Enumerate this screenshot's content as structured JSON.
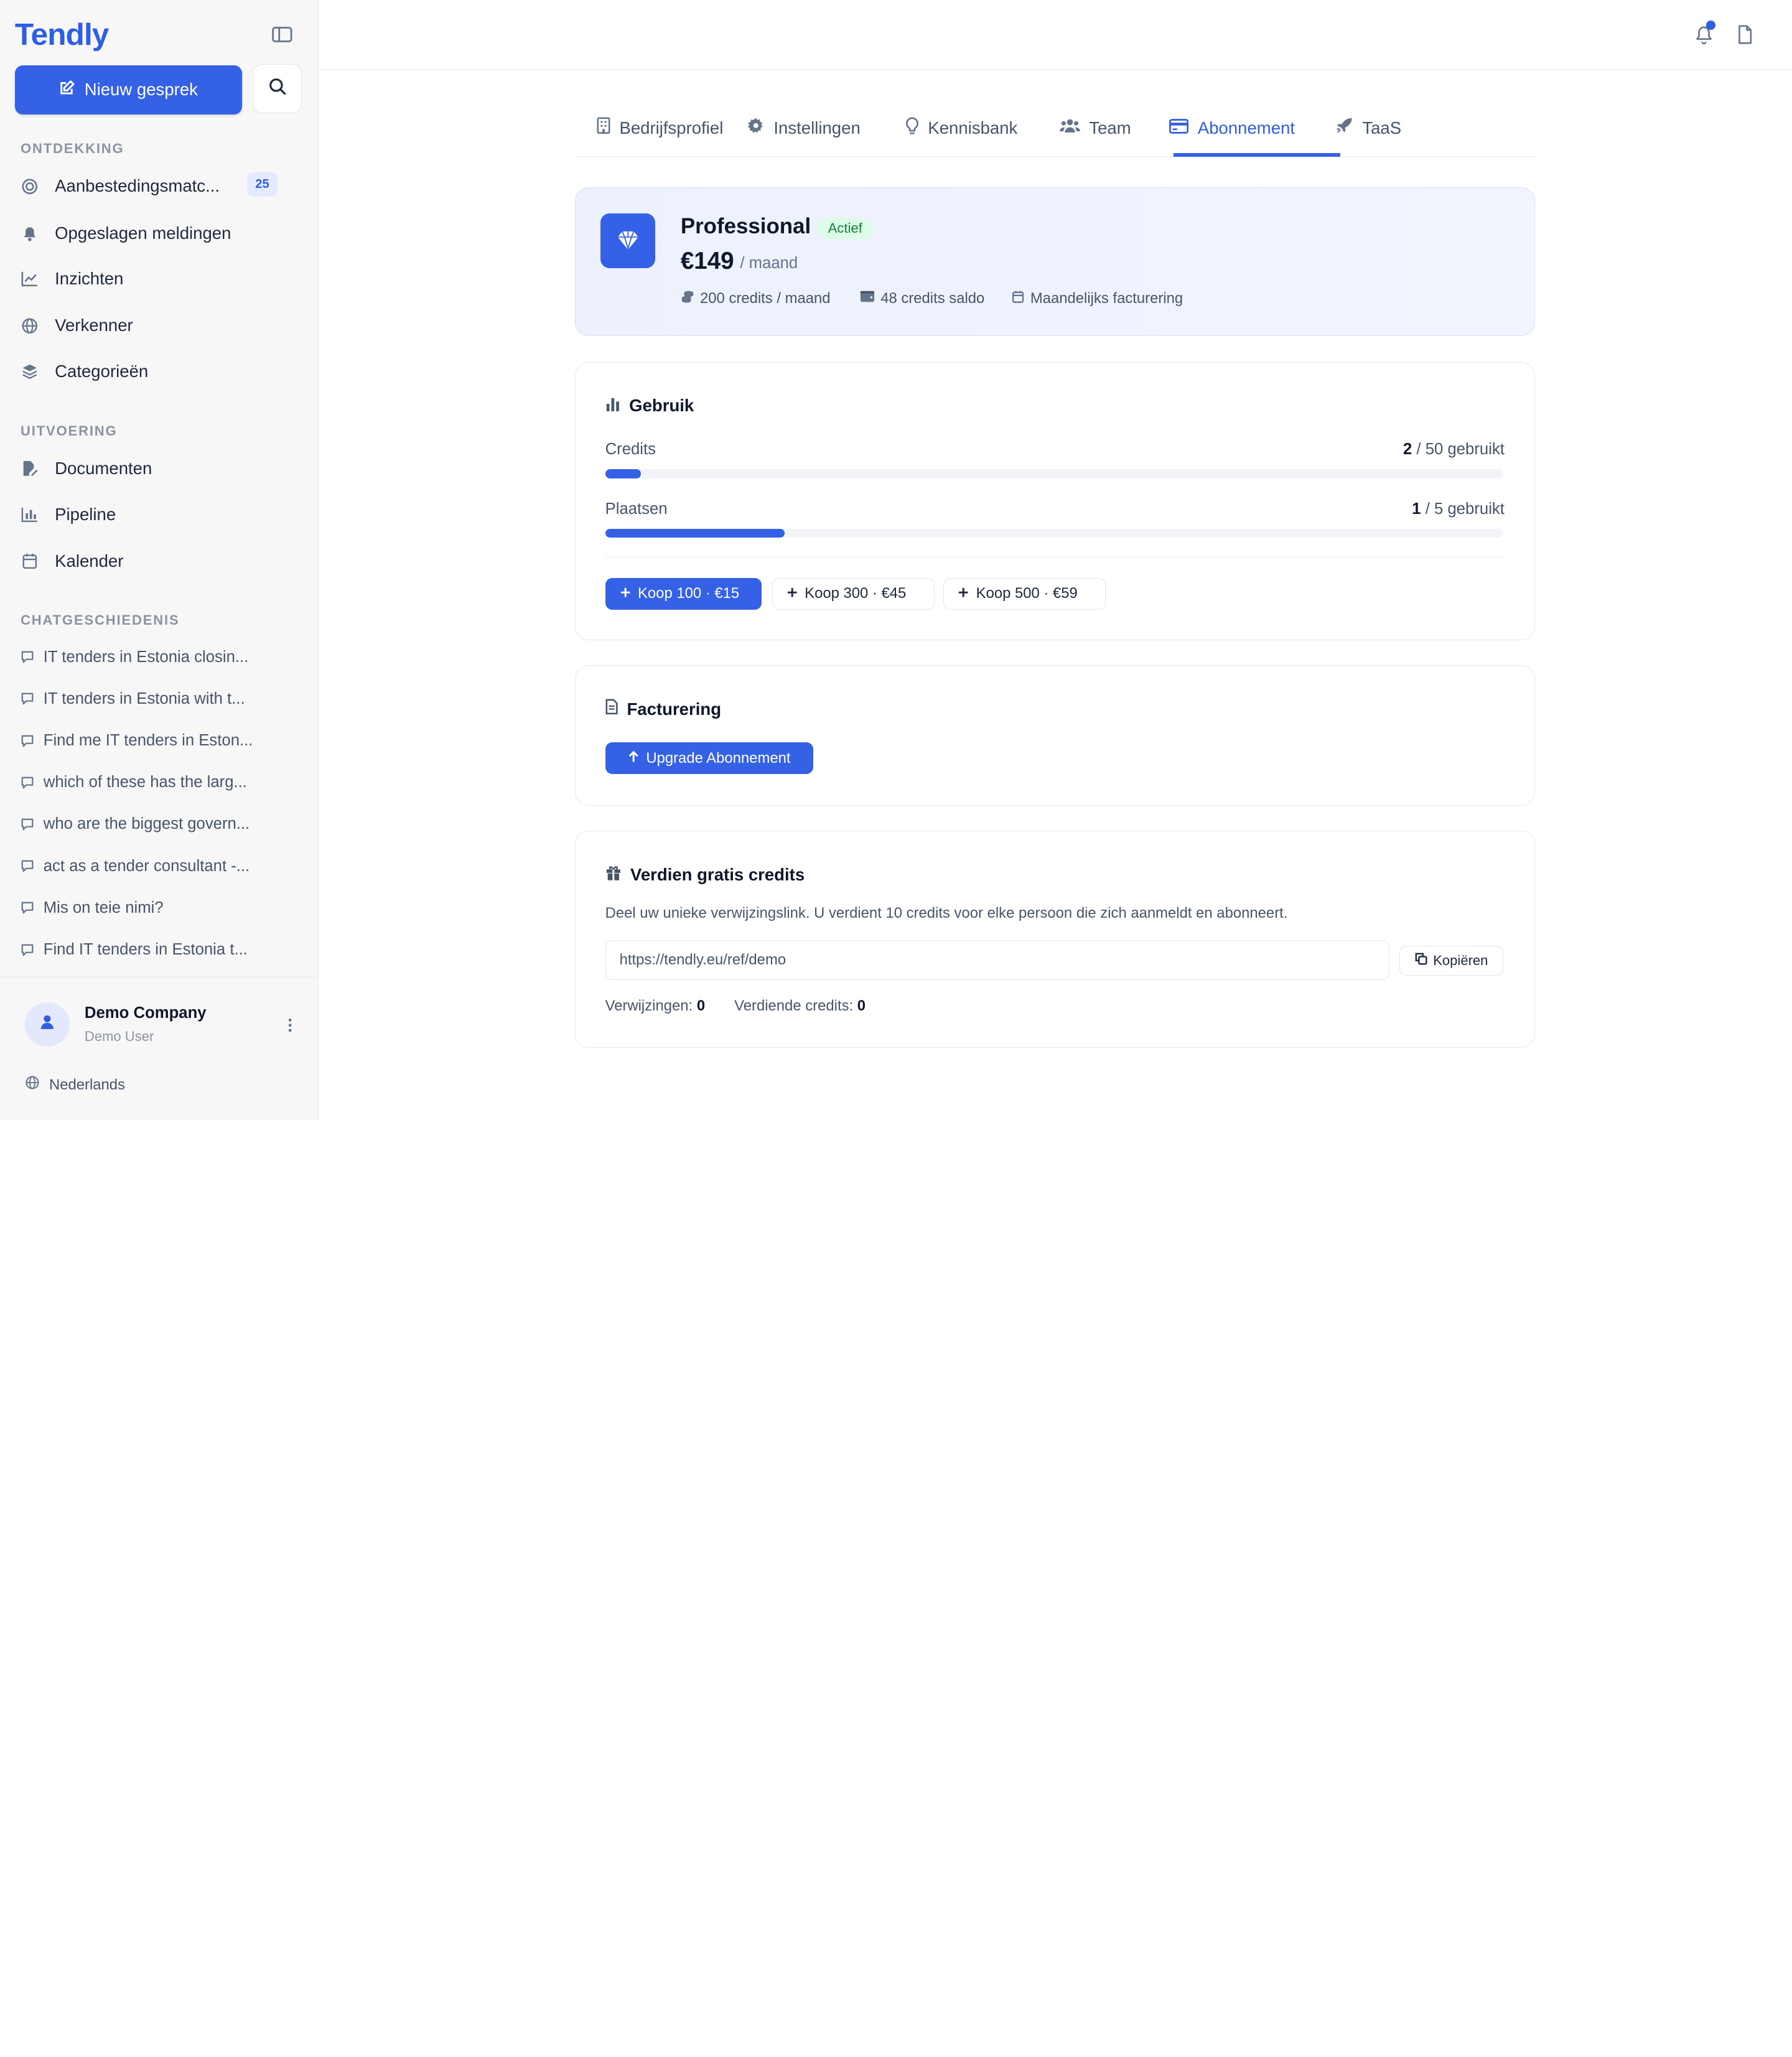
{
  "app": {
    "name": "Tendly"
  },
  "sidebar": {
    "new_chat_label": "Nieuw gesprek",
    "sections": {
      "discovery": "ONTDEKKING",
      "execution": "UITVOERING",
      "history": "CHATGESCHIEDENIS"
    },
    "discovery_items": [
      {
        "label": "Aanbestedingsmatc...",
        "icon": "target-icon",
        "badge": "25"
      },
      {
        "label": "Opgeslagen meldingen",
        "icon": "bell-icon"
      },
      {
        "label": "Inzichten",
        "icon": "line-chart-icon"
      },
      {
        "label": "Verkenner",
        "icon": "globe-icon"
      },
      {
        "label": "Categorieën",
        "icon": "layers-icon"
      }
    ],
    "execution_items": [
      {
        "label": "Documenten",
        "icon": "file-edit-icon"
      },
      {
        "label": "Pipeline",
        "icon": "bar-chart-icon"
      },
      {
        "label": "Kalender",
        "icon": "calendar-icon"
      }
    ],
    "chat_history": [
      "IT tenders in Estonia closin...",
      "IT tenders in Estonia with t...",
      "Find me IT tenders in Eston...",
      "which of these has the larg...",
      "who are the biggest govern...",
      "act as a tender consultant -...",
      "Mis on teie nimi?",
      "Find IT tenders in Estonia t..."
    ],
    "user": {
      "company": "Demo Company",
      "name": "Demo User"
    },
    "language": "Nederlands"
  },
  "tabs": [
    {
      "label": "Bedrijfsprofiel",
      "icon": "building-icon"
    },
    {
      "label": "Instellingen",
      "icon": "gear-icon"
    },
    {
      "label": "Kennisbank",
      "icon": "lightbulb-icon"
    },
    {
      "label": "Team",
      "icon": "users-icon"
    },
    {
      "label": "Abonnement",
      "icon": "credit-card-icon",
      "active": true
    },
    {
      "label": "TaaS",
      "icon": "rocket-icon"
    }
  ],
  "plan": {
    "name": "Professional",
    "status": "Actief",
    "price": "€149",
    "period": "/ maand",
    "meta": [
      {
        "text": "200 credits / maand",
        "icon": "coins-icon"
      },
      {
        "text": "48 credits saldo",
        "icon": "wallet-icon"
      },
      {
        "text": "Maandelijks facturering",
        "icon": "calendar-icon"
      }
    ]
  },
  "usage": {
    "title": "Gebruik",
    "credits": {
      "label": "Credits",
      "used": "2",
      "suffix": "/ 50 gebruikt",
      "fraction": 0.04
    },
    "seats": {
      "label": "Plaatsen",
      "used": "1",
      "suffix": "/ 5 gebruikt",
      "fraction": 0.2
    },
    "buy_options": [
      "Koop 100 · €15",
      "Koop 300 · €45",
      "Koop 500 · €59"
    ]
  },
  "billing": {
    "title": "Facturering",
    "upgrade_label": "Upgrade Abonnement"
  },
  "referral": {
    "title": "Verdien gratis credits",
    "description": "Deel uw unieke verwijzingslink. U verdient 10 credits voor elke persoon die zich aanmeldt en abonneert.",
    "link": "https://tendly.eu/ref/demo",
    "copy_label": "Kopiëren",
    "referrals_label": "Verwijzingen:",
    "referrals_value": "0",
    "earned_label": "Verdiende credits:",
    "earned_value": "0"
  },
  "colors": {
    "accent": "#3461e6",
    "active_badge_bg": "#dcfce7",
    "active_badge_text": "#15803d"
  }
}
